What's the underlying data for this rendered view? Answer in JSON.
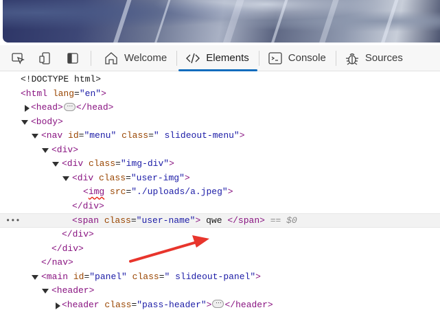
{
  "devtools": {
    "tabs": [
      {
        "label": "Welcome",
        "icon": "home-icon"
      },
      {
        "label": "Elements",
        "icon": "code-icon"
      },
      {
        "label": "Console",
        "icon": "console-icon"
      },
      {
        "label": "Sources",
        "icon": "bug-icon"
      }
    ],
    "active_tab": "Elements",
    "accent_color": "#0f6cbd"
  },
  "dom": {
    "doctype": "<!DOCTYPE html>",
    "html_open": "<html",
    "lang_attr": "lang",
    "lang_val": "\"en\"",
    "html_close_bracket": ">",
    "head_open": "<head>",
    "head_close": "</head>",
    "body_open": "<body>",
    "nav_open": "<nav",
    "id_attr": "id",
    "menu_val": "\"menu\"",
    "class_attr": "class",
    "slideout_menu_val": "\" slideout-menu\"",
    "div_open": "<div>",
    "div_tag": "<div",
    "img_div_val": "\"img-div\"",
    "user_img_val": "\"user-img\"",
    "img_tag": "img",
    "src_attr": "src",
    "src_val": "\"./uploads/a.jpeg\"",
    "div_close": "</div>",
    "span_open": "<span",
    "user_name_val": "\"user-name\"",
    "span_text": " qwe ",
    "span_close": "</span>",
    "dollar_zero": "== $0",
    "nav_close": "</nav>",
    "main_open": "<main",
    "panel_val": "\"panel\"",
    "slideout_panel_val": "\" slideout-panel\"",
    "header_open": "<header>",
    "header_tag": "<header",
    "pass_header_val": "\"pass-header\"",
    "header_close": "</header>",
    "ellipsis": "⋯",
    "row_menu": "•••"
  }
}
